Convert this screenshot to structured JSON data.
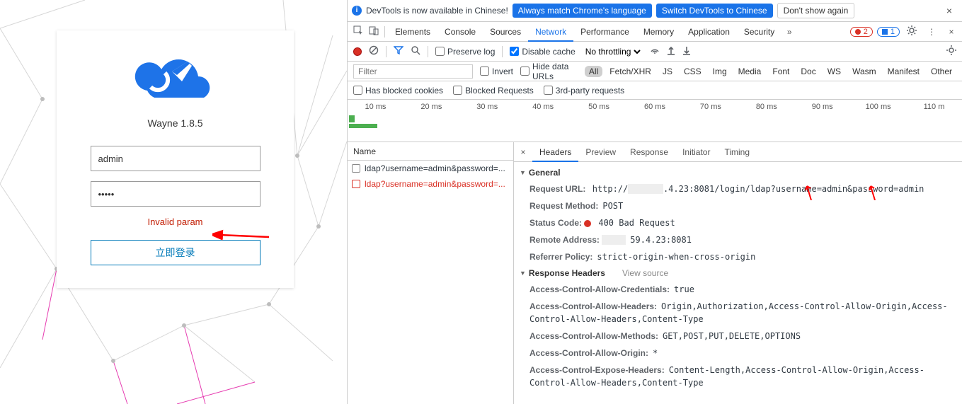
{
  "login": {
    "app_title": "Wayne 1.8.5",
    "username_value": "admin",
    "password_value": "•••••",
    "error": "Invalid param",
    "submit_label": "立即登录"
  },
  "devtools": {
    "infobar": {
      "message": "DevTools is now available in Chinese!",
      "always_match": "Always match Chrome's language",
      "switch_to": "Switch DevTools to Chinese",
      "dont_show": "Don't show again"
    },
    "top_tabs": [
      "Elements",
      "Console",
      "Sources",
      "Network",
      "Performance",
      "Memory",
      "Application",
      "Security"
    ],
    "top_tab_active": "Network",
    "error_count": "2",
    "issue_count": "1",
    "toolbar": {
      "preserve_log": "Preserve log",
      "disable_cache": "Disable cache",
      "throttling": "No throttling"
    },
    "filter": {
      "placeholder": "Filter",
      "invert": "Invert",
      "hide_data_urls": "Hide data URLs",
      "types": [
        "All",
        "Fetch/XHR",
        "JS",
        "CSS",
        "Img",
        "Media",
        "Font",
        "Doc",
        "WS",
        "Wasm",
        "Manifest",
        "Other"
      ],
      "active_type": "All",
      "has_blocked_cookies": "Has blocked cookies",
      "blocked_requests": "Blocked Requests",
      "third_party": "3rd-party requests"
    },
    "timeline_ticks": [
      "10 ms",
      "20 ms",
      "30 ms",
      "40 ms",
      "50 ms",
      "60 ms",
      "70 ms",
      "80 ms",
      "90 ms",
      "100 ms",
      "110 m"
    ],
    "req_list": {
      "header": "Name",
      "rows": [
        {
          "name": "ldap?username=admin&password=...",
          "err": false
        },
        {
          "name": "ldap?username=admin&password=...",
          "err": true
        }
      ]
    },
    "detail_tabs": [
      "Headers",
      "Preview",
      "Response",
      "Initiator",
      "Timing"
    ],
    "detail_active": "Headers",
    "general": {
      "title": "General",
      "request_url_k": "Request URL:",
      "request_url_pre": "http://",
      "request_url_post": ".4.23:8081/login/ldap?username=admin&password=admin",
      "request_method_k": "Request Method:",
      "request_method_v": "POST",
      "status_code_k": "Status Code:",
      "status_code_v": "400 Bad Request",
      "remote_addr_k": "Remote Address:",
      "remote_addr_v": "59.4.23:8081",
      "referrer_k": "Referrer Policy:",
      "referrer_v": "strict-origin-when-cross-origin"
    },
    "response_headers": {
      "title": "Response Headers",
      "view_source": "View source",
      "items": [
        {
          "k": "Access-Control-Allow-Credentials:",
          "v": "true"
        },
        {
          "k": "Access-Control-Allow-Headers:",
          "v": "Origin,Authorization,Access-Control-Allow-Origin,Access-Control-Allow-Headers,Content-Type"
        },
        {
          "k": "Access-Control-Allow-Methods:",
          "v": "GET,POST,PUT,DELETE,OPTIONS"
        },
        {
          "k": "Access-Control-Allow-Origin:",
          "v": "*"
        },
        {
          "k": "Access-Control-Expose-Headers:",
          "v": "Content-Length,Access-Control-Allow-Origin,Access-Control-Allow-Headers,Content-Type"
        }
      ]
    }
  }
}
